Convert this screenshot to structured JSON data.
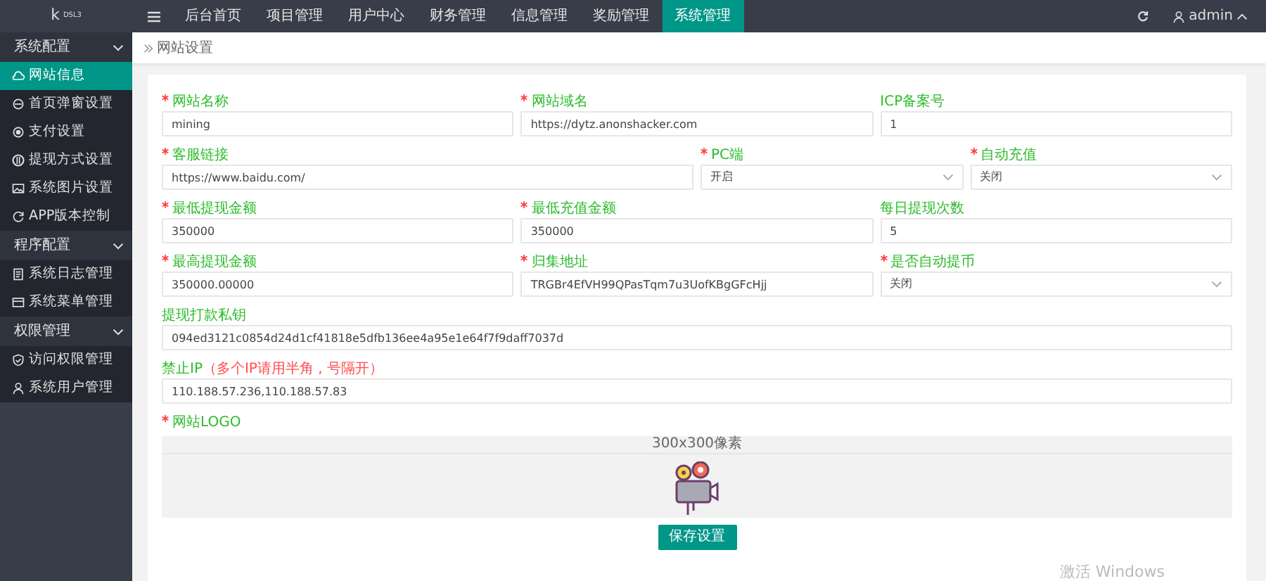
{
  "logo": {
    "letter": "k",
    "sup": "DSL3"
  },
  "topnav": [
    {
      "label": "后台首页",
      "selected": false
    },
    {
      "label": "项目管理",
      "selected": false
    },
    {
      "label": "用户中心",
      "selected": false
    },
    {
      "label": "财务管理",
      "selected": false
    },
    {
      "label": "信息管理",
      "selected": false
    },
    {
      "label": "奖励管理",
      "selected": false
    },
    {
      "label": "系统管理",
      "selected": true
    }
  ],
  "user": {
    "name": "admin"
  },
  "sidebar": [
    {
      "label": "系统配置",
      "expanded": true,
      "children": [
        {
          "label": "网站信息",
          "selected": true
        },
        {
          "label": "首页弹窗设置",
          "selected": false
        },
        {
          "label": "支付设置",
          "selected": false
        },
        {
          "label": "提现方式设置",
          "selected": false
        },
        {
          "label": "系统图片设置",
          "selected": false
        },
        {
          "label": "APP版本控制",
          "selected": false
        }
      ]
    },
    {
      "label": "程序配置",
      "expanded": true,
      "children": [
        {
          "label": "系统日志管理",
          "selected": false
        },
        {
          "label": "系统菜单管理",
          "selected": false
        }
      ]
    },
    {
      "label": "权限管理",
      "expanded": true,
      "children": [
        {
          "label": "访问权限管理",
          "selected": false
        },
        {
          "label": "系统用户管理",
          "selected": false
        }
      ]
    }
  ],
  "breadcrumb": "网站设置",
  "form_rows": [
    [
      {
        "kind": "input",
        "label": "网站名称",
        "required": true,
        "value": "mining"
      },
      {
        "kind": "input",
        "label": "网站域名",
        "required": true,
        "value": "https://dytz.anonshacker.com"
      },
      {
        "kind": "input",
        "label": "ICP备案号",
        "required": false,
        "value": "1"
      }
    ],
    [
      {
        "kind": "input",
        "label": "客服链接",
        "required": true,
        "value": "https://www.baidu.com/"
      },
      {
        "kind": "select",
        "label": "PC端",
        "required": true,
        "value": "开启"
      },
      {
        "kind": "select",
        "label": "自动充值",
        "required": true,
        "value": "关闭"
      }
    ],
    [
      {
        "kind": "input",
        "label": "最低提现金额",
        "required": true,
        "value": "350000"
      },
      {
        "kind": "input",
        "label": "最低充值金额",
        "required": true,
        "value": "350000"
      },
      {
        "kind": "input",
        "label": "每日提现次数",
        "required": false,
        "value": "5"
      }
    ],
    [
      {
        "kind": "input",
        "label": "最高提现金额",
        "required": true,
        "value": "350000.00000"
      },
      {
        "kind": "input",
        "label": "归集地址",
        "required": true,
        "value": "TRGBr4EfVH99QPasTqm7u3UofKBgGFcHjj"
      },
      {
        "kind": "select",
        "label": "是否自动提币",
        "required": true,
        "value": "关闭"
      }
    ],
    [
      {
        "kind": "input",
        "label": "提现打款私钥",
        "required": false,
        "value": "094ed3121c0854d24d1cf41818e5dfb136ee4a95e1e64f7f9daff7037d"
      }
    ],
    [
      {
        "kind": "input",
        "label": "禁止IP",
        "hint": "（多个IP请用半角 , 号隔开）",
        "required": false,
        "value": "110.188.57.236,110.188.57.83"
      }
    ]
  ],
  "logo_upload": {
    "label": "网站LOGO",
    "required": true,
    "size_hint": "300x300像素"
  },
  "save_button": "保存设置",
  "os_notice": "激活 Windows"
}
